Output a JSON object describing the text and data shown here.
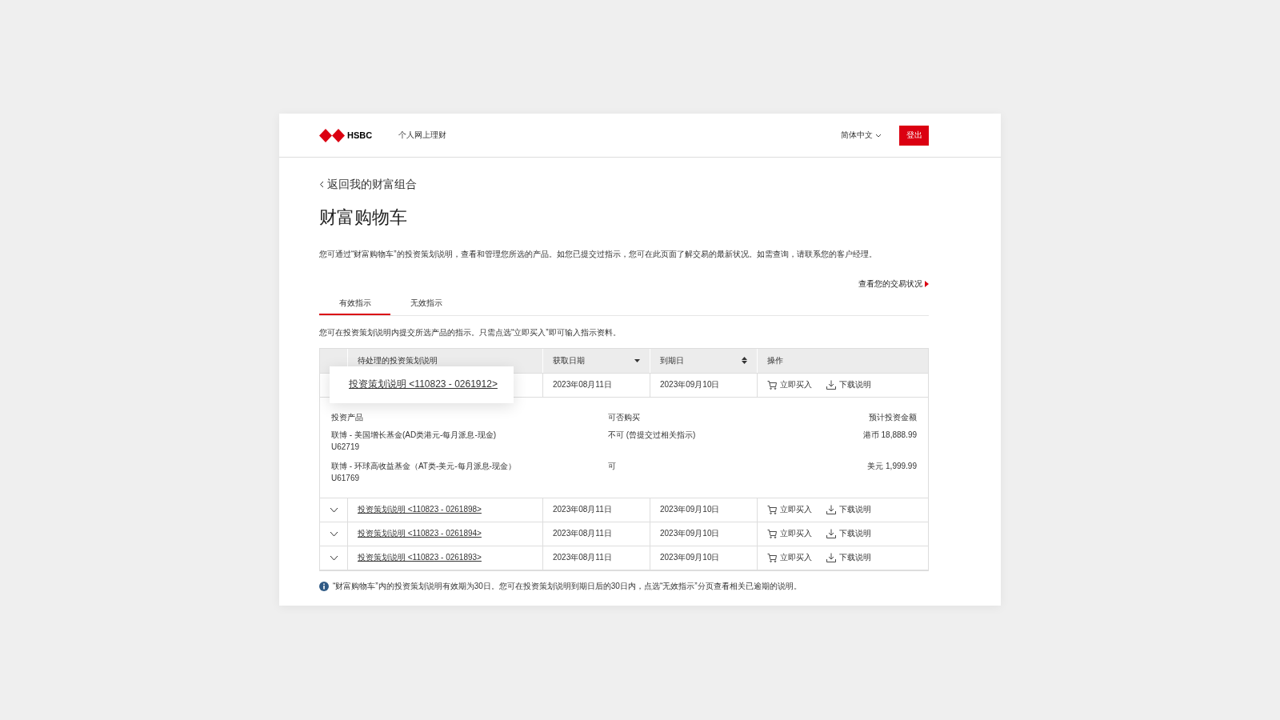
{
  "header": {
    "logo_text": "HSBC",
    "site_name": "个人网上理财",
    "language": "简体中文",
    "logout": "登出"
  },
  "back_link": "返回我的财富组合",
  "title": "财富购物车",
  "intro": "您可通过“财富购物车”的投资策划说明，查看和管理您所选的产品。如您已提交过指示，您可在此页面了解交易的最新状况。如需查询，请联系您的客户经理。",
  "status_link": "查看您的交易状况",
  "tabs": [
    {
      "label": "有效指示",
      "selected": true
    },
    {
      "label": "无效指示",
      "selected": false
    }
  ],
  "hint": "您可在投资策划说明内提交所选产品的指示。只需点选“立即买入”即可输入指示资料。",
  "table": {
    "columns": [
      {
        "label": "待处理的投资策划说明",
        "kind": "plain"
      },
      {
        "label": "获取日期",
        "kind": "sortdown"
      },
      {
        "label": "到期日",
        "kind": "sortable"
      },
      {
        "label": "操作",
        "kind": "plain"
      }
    ],
    "rows": [
      {
        "plan": "投资策划说明 <110823 - 0261912>",
        "acquired": "2023年08月11日",
        "expiry": "2023年09月10日",
        "buy": "立即买入",
        "download": "下载说明",
        "expanded": true,
        "callout": true,
        "details": {
          "columns": [
            "投资产品",
            "可否购买",
            "预计投资金额"
          ],
          "products": [
            {
              "name": "联博 - 美国增长基金(AD类港元-每月派息-现金)",
              "code": "U62719",
              "availability": "不可 (曾提交过相关指示)",
              "amount": "港币 18,888.99"
            },
            {
              "name": "联博 - 环球高收益基金（AT类-美元-每月派息-现金）",
              "code": "U61769",
              "availability": "可",
              "amount": "美元 1,999.99"
            }
          ]
        }
      },
      {
        "plan": "投资策划说明 <110823 - 0261898>",
        "acquired": "2023年08月11日",
        "expiry": "2023年09月10日",
        "buy": "立即买入",
        "download": "下载说明",
        "expanded": false,
        "callout": false
      },
      {
        "plan": "投资策划说明 <110823 - 0261894>",
        "acquired": "2023年08月11日",
        "expiry": "2023年09月10日",
        "buy": "立即买入",
        "download": "下载说明",
        "expanded": false,
        "callout": false
      },
      {
        "plan": "投资策划说明 <110823 - 0261893>",
        "acquired": "2023年08月11日",
        "expiry": "2023年09月10日",
        "buy": "立即买入",
        "download": "下载说明",
        "expanded": false,
        "callout": false
      }
    ]
  },
  "footnote": "“财富购物车”内的投资策划说明有效期为30日。您可在投资策划说明到期日后的30日内，点选“无效指示”分页查看相关已逾期的说明。"
}
